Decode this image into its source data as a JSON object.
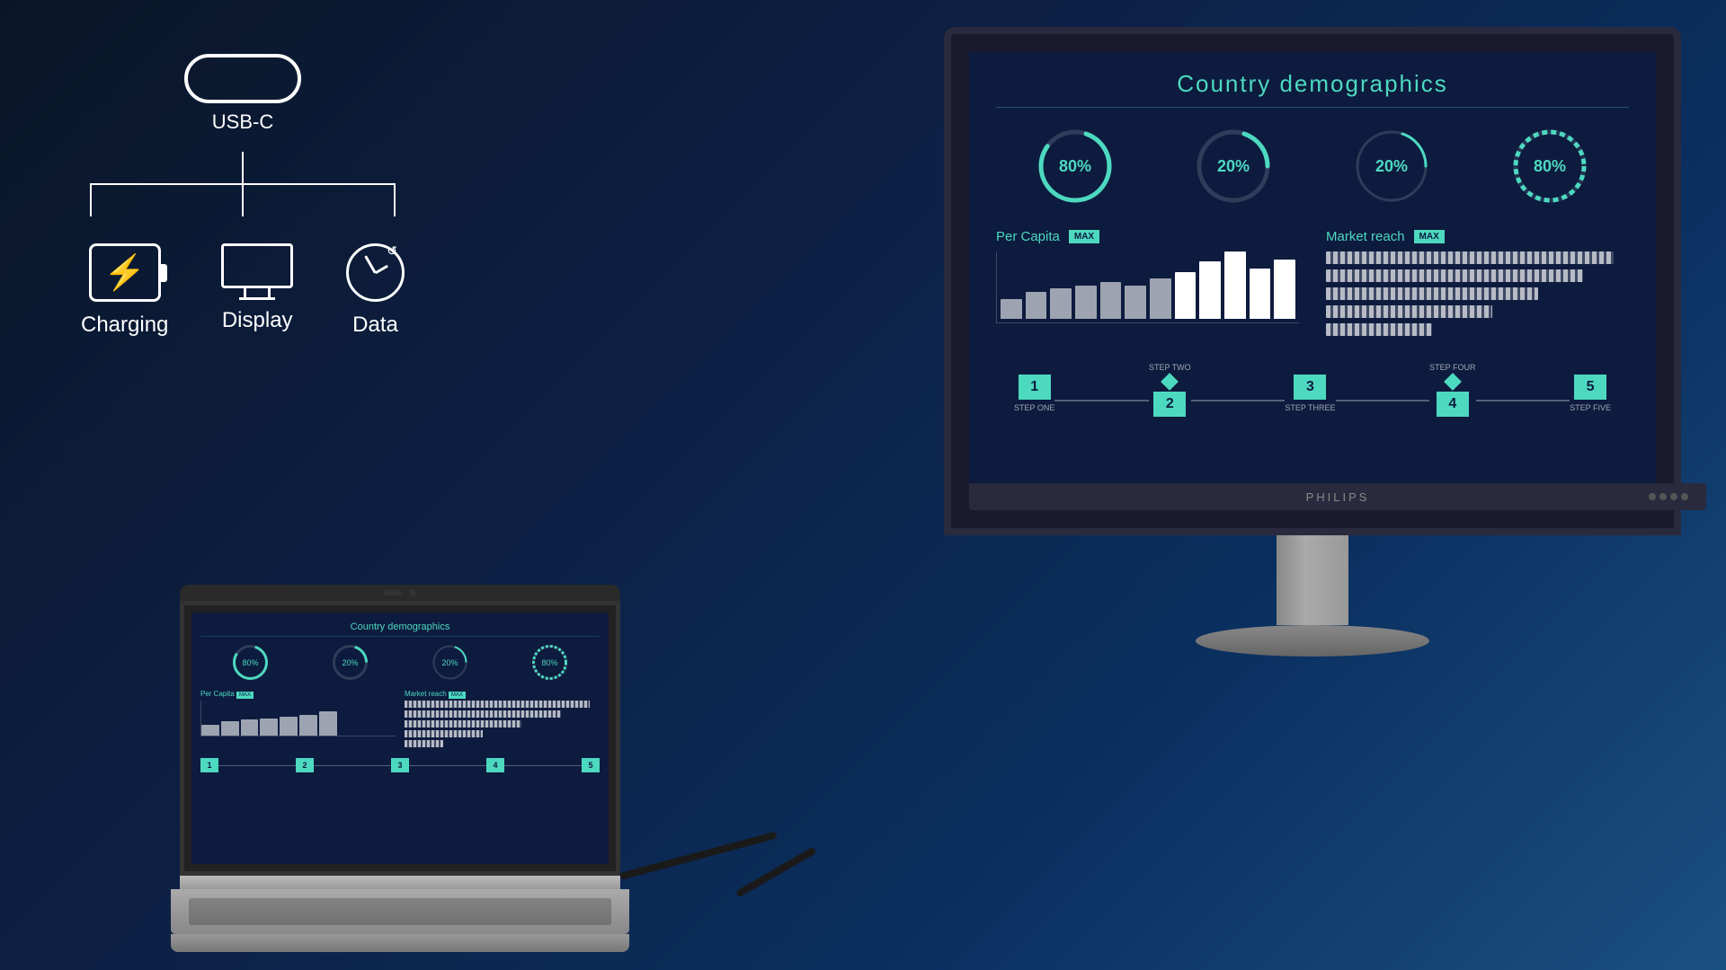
{
  "background": {
    "gradient_start": "#0a1628",
    "gradient_end": "#1a5080"
  },
  "usb_diagram": {
    "connector_label": "USB-C",
    "items": [
      {
        "id": "charging",
        "label": "Charging",
        "icon": "charging-icon"
      },
      {
        "id": "display",
        "label": "Display",
        "icon": "display-icon"
      },
      {
        "id": "data",
        "label": "Data",
        "icon": "data-icon"
      }
    ]
  },
  "monitor": {
    "brand": "PHILIPS",
    "screen": {
      "title": "Country demographics",
      "gauges": [
        {
          "value": "80%",
          "percent": 80
        },
        {
          "value": "20%",
          "percent": 20
        },
        {
          "value": "20%",
          "percent": 20
        },
        {
          "value": "80%",
          "percent": 80,
          "dashed": true
        }
      ],
      "charts": {
        "bar_chart": {
          "title": "Per Capita",
          "badge": "MAX",
          "bars": [
            30,
            45,
            50,
            55,
            60,
            55,
            65,
            70,
            80,
            90,
            75,
            85
          ]
        },
        "horizontal_chart": {
          "title": "Market reach",
          "badge": "MAX",
          "bars": [
            95,
            85,
            60,
            40,
            20
          ]
        }
      },
      "steps": [
        {
          "number": "1",
          "label_top": "",
          "label_bottom": "STEP ONE"
        },
        {
          "number": "2",
          "label_top": "STEP TWO",
          "label_bottom": ""
        },
        {
          "number": "3",
          "label_top": "",
          "label_bottom": "STEP THREE"
        },
        {
          "number": "4",
          "label_top": "STEP FOUR",
          "label_bottom": ""
        },
        {
          "number": "5",
          "label_top": "",
          "label_bottom": "STEP FIVE"
        }
      ]
    }
  },
  "laptop": {
    "screen_title": "Country demographics"
  },
  "accent_color": "#4dd9c0",
  "dark_bg": "#0d1b3e"
}
